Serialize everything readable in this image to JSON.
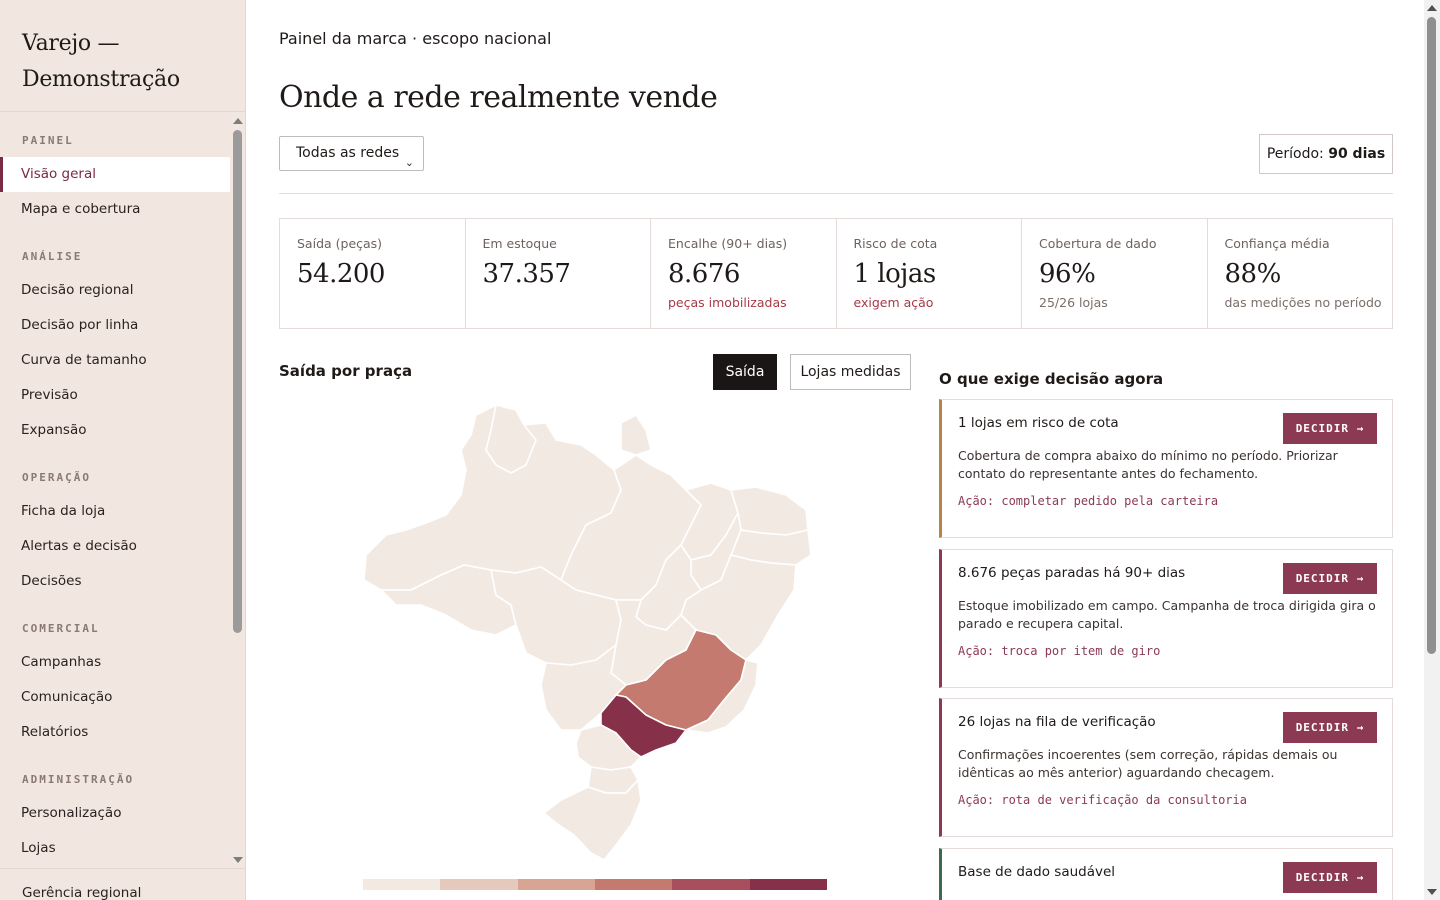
{
  "brand": {
    "line1": "Varejo —",
    "line2": "Demonstração"
  },
  "nav": {
    "sections": [
      {
        "title": "PAINEL",
        "items": [
          "Visão geral",
          "Mapa e cobertura"
        ]
      },
      {
        "title": "ANÁLISE",
        "items": [
          "Decisão regional",
          "Decisão por linha",
          "Curva de tamanho",
          "Previsão",
          "Expansão"
        ]
      },
      {
        "title": "OPERAÇÃO",
        "items": [
          "Ficha da loja",
          "Alertas e decisão",
          "Decisões"
        ]
      },
      {
        "title": "COMERCIAL",
        "items": [
          "Campanhas",
          "Comunicação",
          "Relatórios"
        ]
      },
      {
        "title": "ADMINISTRAÇÃO",
        "items": [
          "Personalização",
          "Lojas"
        ]
      }
    ],
    "active": "Visão geral",
    "footer": "Gerência regional"
  },
  "header": {
    "context": "Painel da marca · escopo nacional",
    "title": "Onde a rede realmente vende",
    "network_select": "Todas as redes",
    "period_label": "Período:",
    "period_value": "90 dias"
  },
  "kpis": [
    {
      "label": "Saída (peças)",
      "value": "54.200",
      "sub": ""
    },
    {
      "label": "Em estoque",
      "value": "37.357",
      "sub": ""
    },
    {
      "label": "Encalhe (90+ dias)",
      "value": "8.676",
      "sub": "peças imobilizadas",
      "sub_style": "alert"
    },
    {
      "label": "Risco de cota",
      "value": "1 lojas",
      "sub": "exigem ação",
      "sub_style": "alert"
    },
    {
      "label": "Cobertura de dado",
      "value": "96%",
      "sub": "25/26 lojas",
      "sub_style": "muted"
    },
    {
      "label": "Confiança média",
      "value": "88%",
      "sub": "das medições no período",
      "sub_style": "muted"
    }
  ],
  "map": {
    "title": "Saída por praça",
    "toggle_active": "Saída",
    "toggle_other": "Lojas medidas",
    "base_color": "#f3e9e3",
    "highlight_colors": {
      "sao_paulo": "#86304a",
      "minas_gerais": "#c47a6e"
    },
    "legend_colors": [
      "#f3e9e3",
      "#e6c9bd",
      "#d6a593",
      "#c47a6e",
      "#a84f5e",
      "#86304a"
    ]
  },
  "decisions": {
    "title": "O que exige decisão agora",
    "button_label": "DECIDIR →",
    "cards": [
      {
        "heading": "1 lojas em risco de cota",
        "text": "Cobertura de compra abaixo do mínimo no período. Priorizar contato do representante antes do fechamento.",
        "action": "Ação: completar pedido pela carteira",
        "severity": "warn"
      },
      {
        "heading": "8.676 peças paradas há 90+ dias",
        "text": "Estoque imobilizado em campo. Campanha de troca dirigida gira o parado e recupera capital.",
        "action": "Ação: troca por item de giro",
        "severity": "critical"
      },
      {
        "heading": "26 lojas na fila de verificação",
        "text": "Confirmações incoerentes (sem correção, rápidas demais ou idênticas ao mês anterior) aguardando checagem.",
        "action": "Ação: rota de verificação da consultoria",
        "severity": "critical"
      },
      {
        "heading": "Base de dado saudável",
        "text": "",
        "action": "",
        "severity": "ok"
      }
    ]
  }
}
